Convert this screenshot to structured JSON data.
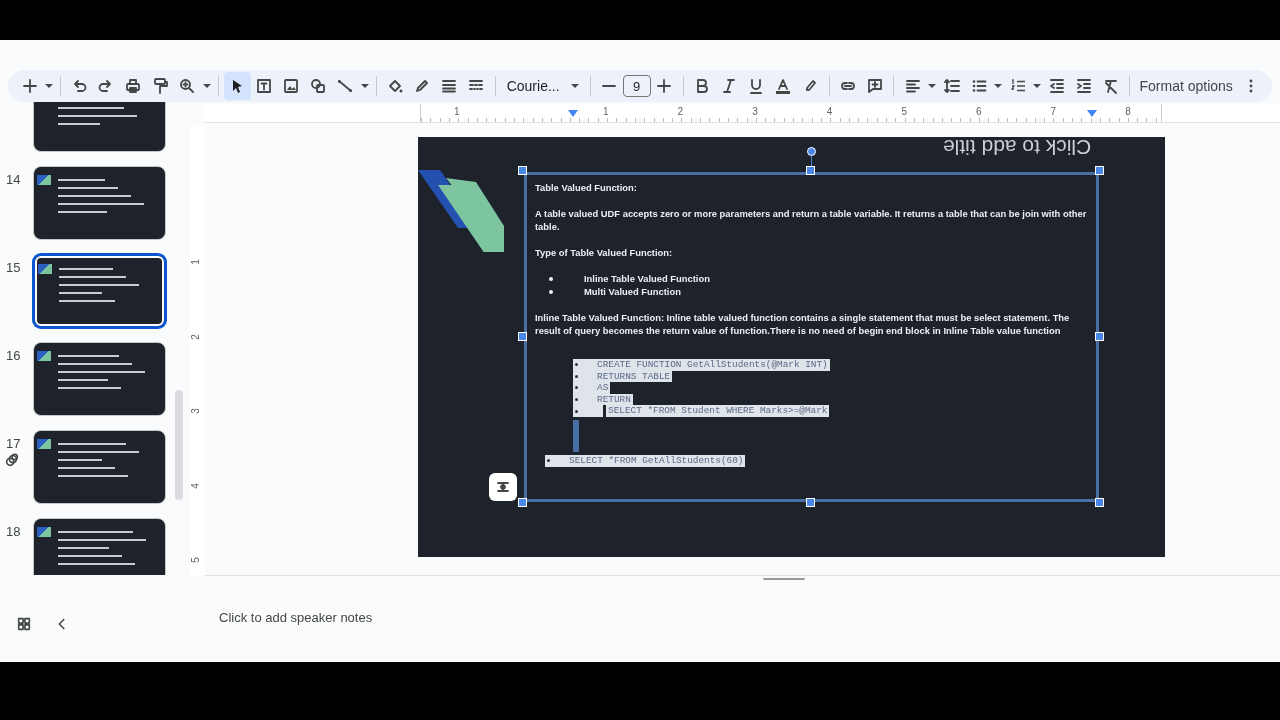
{
  "toolbar": {
    "pointer_selected": true,
    "font": "Courie...",
    "font_size": "9",
    "format_options": "Format options"
  },
  "slide_panel": {
    "slides": [
      {
        "selected": false
      },
      {
        "number": "14",
        "selected": false
      },
      {
        "number": "15",
        "selected": true
      },
      {
        "number": "16",
        "selected": false
      },
      {
        "number": "17",
        "selected": false
      },
      {
        "number": "18",
        "selected": false
      }
    ]
  },
  "rulers": {
    "horizontal": [
      "1",
      "1",
      "2",
      "3",
      "4",
      "5",
      "6",
      "7",
      "8"
    ],
    "vertical": [
      "1",
      "2",
      "3",
      "4",
      "5"
    ]
  },
  "slide": {
    "title_placeholder": "Click to add title",
    "heading": "Table Valued Function:",
    "paragraph": "A table valued UDF accepts zero or more parameters and return a table variable. It returns a table that can be join with other table.",
    "subheading": "Type of Table Valued Function:",
    "bullets": [
      "Inline Table Valued Function",
      "Multi Valued Function"
    ],
    "description": "Inline Table Valued Function: Inline table valued function contains a single statement that must be select statement. The result of query becomes the return value of function.There is no need of begin end block in Inline Table value function",
    "code_lines": [
      {
        "text": "CREATE FUNCTION GetAllStudents(@Mark INT)",
        "indented": false
      },
      {
        "text": "RETURNS TABLE",
        "indented": false
      },
      {
        "text": "AS",
        "indented": false
      },
      {
        "text": "RETURN",
        "indented": false
      },
      {
        "text": "SELECT *FROM Student WHERE Marks>=@Mark",
        "indented": true
      }
    ],
    "query_line": "SELECT *FROM GetAllStudents(60)"
  },
  "speaker_notes": {
    "placeholder": "Click to add speaker notes"
  }
}
